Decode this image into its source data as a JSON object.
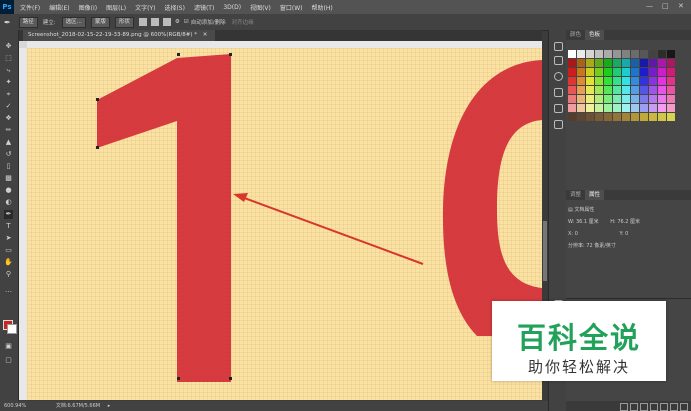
{
  "app": {
    "logo": "Ps"
  },
  "menu": [
    "文件(F)",
    "编辑(E)",
    "图像(I)",
    "图层(L)",
    "文字(Y)",
    "选择(S)",
    "滤镜(T)",
    "3D(D)",
    "视图(V)",
    "窗口(W)",
    "帮助(H)"
  ],
  "options": {
    "mode_value": "路径",
    "build_label": "建立:",
    "selection_button": "选区...",
    "mask_button": "蒙版",
    "shape_button": "形状",
    "auto_add_delete": "自动添加/删除",
    "align_edges": "对齐边缘"
  },
  "document": {
    "tab_title": "Screenshot_2018-02-15-22-19-33-89.png @ 600%(RGB/8#) *",
    "zoom": "600.94%",
    "file_info": "文档:6.67M/5.66M"
  },
  "panels": {
    "top_tabs": [
      "颜色",
      "色板"
    ],
    "top_active": 1,
    "mid_tabs": [
      "调整",
      "属性"
    ],
    "mid_active": 1,
    "doc_props_title": "文档属性",
    "width_label": "W:",
    "width_value": "36.1 厘米",
    "height_label": "H:",
    "height_value": "76.2 厘米",
    "x_label": "X:",
    "x_value": "0",
    "y_label": "Y:",
    "y_value": "0",
    "resolution": "分辨率: 72 像素/英寸"
  },
  "watermark": {
    "title": "百科全说",
    "subtitle": "助你轻松解决"
  },
  "colors": {
    "canvas_bg": "#fbe2a2",
    "glyph_red": "#d3323a",
    "arrow_red": "#d8362c",
    "watermark_green": "#22a15b"
  },
  "icons": [
    "move-icon",
    "marquee-icon",
    "lasso-icon",
    "magic-wand-icon",
    "crop-icon",
    "eyedropper-icon",
    "healing-icon",
    "brush-icon",
    "stamp-icon",
    "history-brush-icon",
    "eraser-icon",
    "gradient-icon",
    "blur-icon",
    "dodge-icon",
    "pen-icon",
    "type-icon",
    "path-select-icon",
    "shape-icon",
    "hand-icon",
    "zoom-icon"
  ]
}
